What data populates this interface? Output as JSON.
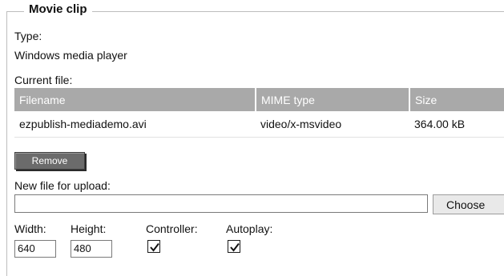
{
  "legend": "Movie clip",
  "type_label": "Type:",
  "type_value": "Windows media player",
  "current_file_label": "Current file:",
  "table": {
    "headers": [
      "Filename",
      "MIME type",
      "Size"
    ],
    "rows": [
      [
        "ezpublish-mediademo.avi",
        "video/x-msvideo",
        "364.00 kB"
      ]
    ]
  },
  "remove_label": "Remove",
  "new_file_label": "New file for upload:",
  "choose_label": "Choose",
  "width_label": "Width:",
  "width_value": "640",
  "height_label": "Height:",
  "height_value": "480",
  "controller_label": "Controller:",
  "controller_checked": true,
  "autoplay_label": "Autoplay:",
  "autoplay_checked": true
}
